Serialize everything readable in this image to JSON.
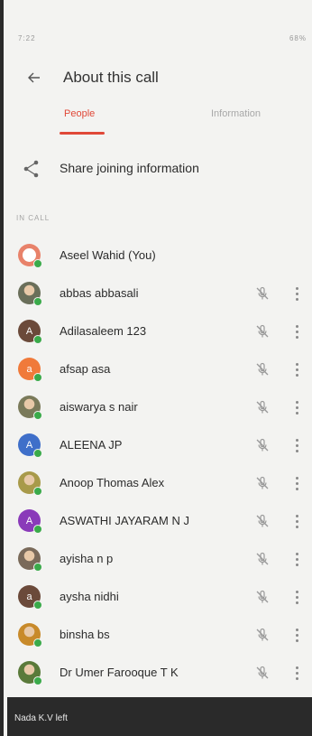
{
  "status_bar": {
    "left": "7:22",
    "right": "68%"
  },
  "header": {
    "title": "About this call"
  },
  "tabs": [
    {
      "label": "People",
      "active": true
    },
    {
      "label": "Information",
      "active": false
    }
  ],
  "share": {
    "label": "Share joining information"
  },
  "section_label": "IN CALL",
  "participants": [
    {
      "name": "Aseel Wahid (You)",
      "avatar": "ring",
      "color": "#e8826a",
      "muted": false
    },
    {
      "name": "abbas abbasali",
      "avatar": "photo",
      "color": "#6a6f5a",
      "muted": true
    },
    {
      "name": "Adilasaleem 123",
      "avatar": "A",
      "color": "#6b4a3a",
      "muted": true
    },
    {
      "name": "afsap asa",
      "avatar": "a",
      "color": "#f07a3a",
      "muted": true
    },
    {
      "name": "aiswarya s nair",
      "avatar": "photo",
      "color": "#7a7a5a",
      "muted": true
    },
    {
      "name": "ALEENA JP",
      "avatar": "A",
      "color": "#3f6fc9",
      "muted": true
    },
    {
      "name": "Anoop Thomas Alex",
      "avatar": "photo",
      "color": "#a89a4a",
      "muted": true
    },
    {
      "name": "ASWATHI JAYARAM N J",
      "avatar": "A",
      "color": "#8a3ab9",
      "muted": true
    },
    {
      "name": "ayisha n p",
      "avatar": "photo",
      "color": "#7a6a5a",
      "muted": true
    },
    {
      "name": "aysha nidhi",
      "avatar": "a",
      "color": "#6b4a3a",
      "muted": true
    },
    {
      "name": "binsha bs",
      "avatar": "photo",
      "color": "#c88a2a",
      "muted": true
    },
    {
      "name": "Dr Umer Farooque T K",
      "avatar": "photo",
      "color": "#5a7a3a",
      "muted": true
    }
  ],
  "toast": {
    "text": "Nada K.V left"
  },
  "colors": {
    "accent": "#e04838",
    "online": "#3aaa4a"
  }
}
